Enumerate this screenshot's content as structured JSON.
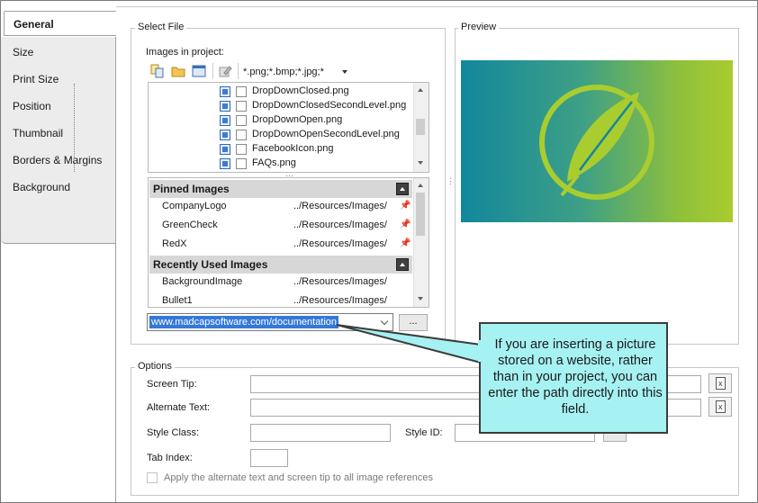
{
  "tabs": [
    {
      "label": "General",
      "active": true
    },
    {
      "label": "Size"
    },
    {
      "label": "Print Size"
    },
    {
      "label": "Position"
    },
    {
      "label": "Thumbnail"
    },
    {
      "label": "Borders & Margins"
    },
    {
      "label": "Background"
    }
  ],
  "select_file": {
    "group_label": "Select File",
    "images_label": "Images in project:",
    "filter_text": "*.png;*.bmp;*.jpg;*",
    "toolbar_icons": [
      "copy-icon",
      "folder-icon",
      "view-icon",
      "edit-image-icon"
    ],
    "files": [
      "DropDownClosed.png",
      "DropDownClosedSecondLevel.png",
      "DropDownOpen.png",
      "DropDownOpenSecondLevel.png",
      "FacebookIcon.png",
      "FAQs.png"
    ],
    "pinned_header": "Pinned Images",
    "pinned": [
      {
        "name": "CompanyLogo",
        "path": "../Resources/Images/"
      },
      {
        "name": "GreenCheck",
        "path": "../Resources/Images/"
      },
      {
        "name": "RedX",
        "path": "../Resources/Images/"
      }
    ],
    "recent_header": "Recently Used Images",
    "recent": [
      {
        "name": "BackgroundImage",
        "path": "../Resources/Images/"
      },
      {
        "name": "Bullet1",
        "path": "../Resources/Images/"
      }
    ],
    "url_value": "www.madcapsoftware.com/documentation",
    "browse_label": "..."
  },
  "preview": {
    "group_label": "Preview",
    "colors": {
      "circle": "#a9cc2f",
      "gradient_start": "#12879c",
      "gradient_end": "#a9cc2f"
    }
  },
  "options": {
    "group_label": "Options",
    "screen_tip_label": "Screen Tip:",
    "screen_tip_value": "",
    "alt_text_label": "Alternate Text:",
    "alt_text_value": "",
    "style_class_label": "Style Class:",
    "style_class_value": "",
    "style_id_label": "Style ID:",
    "style_id_value": "",
    "tab_index_label": "Tab Index:",
    "tab_index_value": "",
    "apply_label": "Apply the alternate text and screen tip to all image references",
    "apply_checked": false,
    "style_id_browse_label": "..."
  },
  "callout": {
    "text": "If you are inserting a picture stored on a website, rather than in your project, you can enter the path directly into this field."
  }
}
